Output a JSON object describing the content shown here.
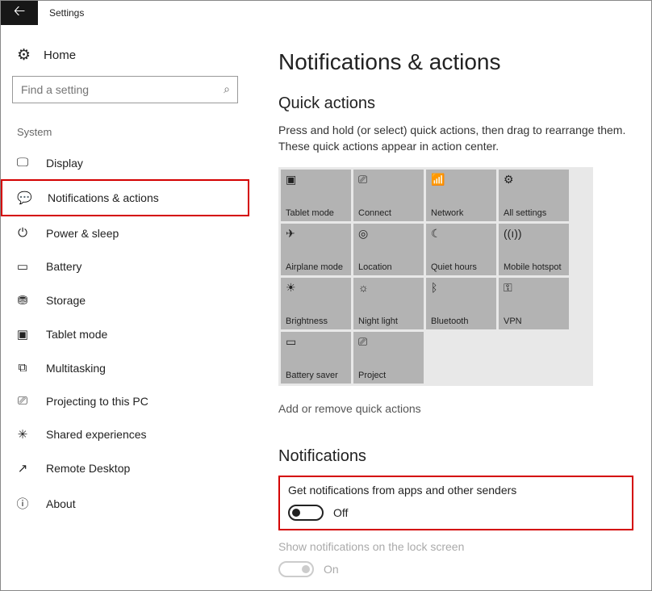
{
  "titlebar": {
    "title": "Settings"
  },
  "home_label": "Home",
  "search": {
    "placeholder": "Find a setting"
  },
  "section_label": "System",
  "nav": [
    {
      "label": "Display"
    },
    {
      "label": "Notifications & actions"
    },
    {
      "label": "Power & sleep"
    },
    {
      "label": "Battery"
    },
    {
      "label": "Storage"
    },
    {
      "label": "Tablet mode"
    },
    {
      "label": "Multitasking"
    },
    {
      "label": "Projecting to this PC"
    },
    {
      "label": "Shared experiences"
    },
    {
      "label": "Remote Desktop"
    },
    {
      "label": "About"
    }
  ],
  "main": {
    "heading": "Notifications & actions",
    "quick_actions_heading": "Quick actions",
    "quick_actions_hint": "Press and hold (or select) quick actions, then drag to rearrange them. These quick actions appear in action center.",
    "tiles": [
      {
        "label": "Tablet mode"
      },
      {
        "label": "Connect"
      },
      {
        "label": "Network"
      },
      {
        "label": "All settings"
      },
      {
        "label": "Airplane mode"
      },
      {
        "label": "Location"
      },
      {
        "label": "Quiet hours"
      },
      {
        "label": "Mobile hotspot"
      },
      {
        "label": "Brightness"
      },
      {
        "label": "Night light"
      },
      {
        "label": "Bluetooth"
      },
      {
        "label": "VPN"
      },
      {
        "label": "Battery saver"
      },
      {
        "label": "Project"
      }
    ],
    "add_remove_link": "Add or remove quick actions",
    "notifications_heading": "Notifications",
    "toggle1_label": "Get notifications from apps and other senders",
    "toggle1_state": "Off",
    "toggle2_label": "Show notifications on the lock screen",
    "toggle2_state": "On"
  }
}
